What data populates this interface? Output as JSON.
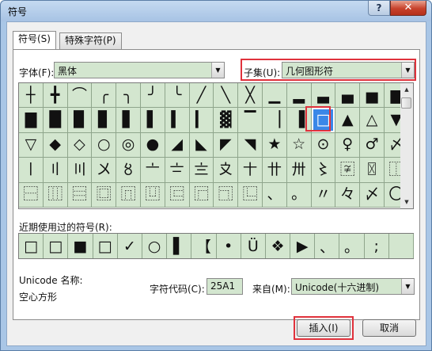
{
  "window": {
    "title": "符号",
    "help_label": "?",
    "close_label": "✕"
  },
  "tabs": [
    {
      "label": "符号(S)"
    },
    {
      "label": "特殊字符(P)"
    }
  ],
  "font": {
    "label": "字体(F):",
    "value": "黑体"
  },
  "subset": {
    "label": "子集(U):",
    "value": "几何图形符"
  },
  "symbols": [
    [
      "┼",
      "╋",
      "⌒",
      "╭",
      "╮",
      "╯",
      "╰",
      "╱",
      "╲",
      "╳",
      "▁",
      "▂",
      "▃",
      "▄",
      "▅",
      "▆"
    ],
    [
      "▇",
      "█",
      "▉",
      "▊",
      "▋",
      "▌",
      "▍",
      "▎",
      "▓",
      "▔",
      "▕",
      "▐",
      "□",
      "▲",
      "△",
      "▼"
    ],
    [
      "▽",
      "◆",
      "◇",
      "○",
      "◎",
      "●",
      "◢",
      "◣",
      "◤",
      "◥",
      "★",
      "☆",
      "⊙",
      "♀",
      "♂",
      "〆"
    ],
    [
      "〡",
      "〢",
      "〣",
      "〤",
      "〥",
      "〦",
      "〧",
      "〨",
      "〩",
      "〸",
      "〹",
      "〺",
      "〻",
      "〾",
      "〿",
      "⿰"
    ],
    [
      "⿱",
      "⿲",
      "⿳",
      "⿴",
      "⿵",
      "⿶",
      "⿷",
      "⿸",
      "⿹",
      "⿺",
      "、",
      "。",
      "〃",
      "々",
      "〆",
      "〇"
    ]
  ],
  "selected_symbol": "□",
  "recent": {
    "label": "近期使用过的符号(R):",
    "items": [
      "□",
      "□",
      "■",
      "□",
      "✓",
      "○",
      "▌",
      "【",
      "•",
      "Ü",
      "❖",
      "▶",
      "、",
      "。",
      ";",
      ""
    ]
  },
  "unicode_name_label": "Unicode 名称:",
  "unicode_name_value": "空心方形",
  "char_code": {
    "label": "字符代码(C):",
    "value": "25A1"
  },
  "from": {
    "label": "来自(M):",
    "value": "Unicode(十六进制)"
  },
  "buttons": {
    "insert": "插入(I)",
    "cancel": "取消"
  },
  "colors": {
    "cell_bg": "#d3e6cf",
    "selection": "#3a87e8",
    "highlight": "#e0323c"
  }
}
